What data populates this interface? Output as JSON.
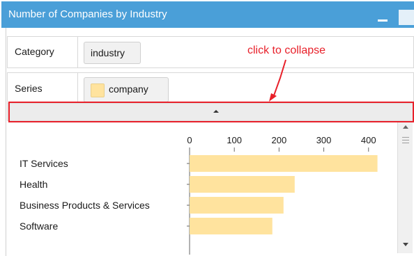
{
  "window": {
    "title": "Number of Companies by Industry"
  },
  "fields": {
    "category_label": "Category",
    "category_field": "industry",
    "series_label": "Series",
    "series_field": "company",
    "series_color": "#ffe39e"
  },
  "annotation": {
    "text": "click to collapse",
    "color": "#e8202a"
  },
  "chart_data": {
    "type": "bar",
    "orientation": "horizontal",
    "categories": [
      "IT Services",
      "Health",
      "Business Products & Services",
      "Software"
    ],
    "series": [
      {
        "name": "company",
        "values": [
          420,
          235,
          210,
          185
        ]
      }
    ],
    "x_ticks": [
      0,
      100,
      200,
      300,
      400
    ],
    "xlim": [
      0,
      430
    ],
    "x_axis_position": "top",
    "grid": false,
    "bar_color": "#ffe39e"
  }
}
